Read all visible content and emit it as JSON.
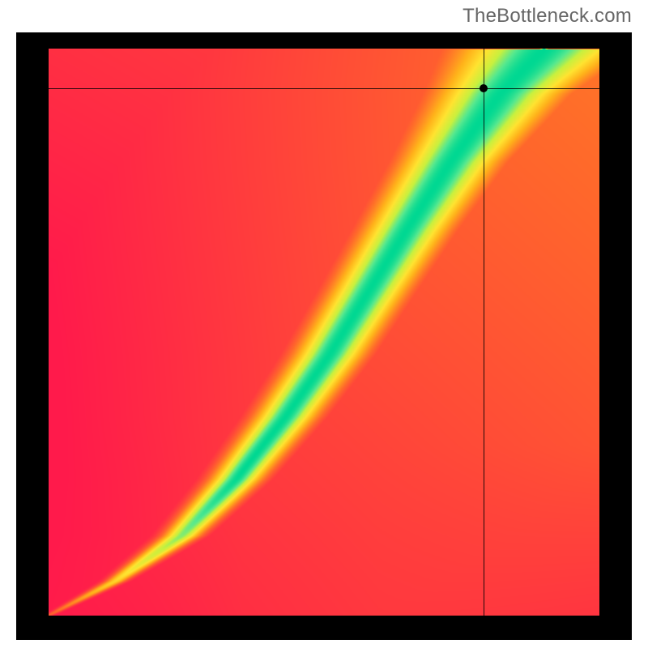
{
  "watermark": "TheBottleneck.com",
  "chart_data": {
    "type": "heatmap",
    "title": "",
    "xlabel": "",
    "ylabel": "",
    "xlim": [
      0,
      100
    ],
    "ylim": [
      0,
      100
    ],
    "grid": false,
    "crosshair": {
      "x": 79,
      "y": 93
    },
    "ridge": [
      {
        "x": 0,
        "y": 0,
        "half_width": 0.5
      },
      {
        "x": 12,
        "y": 6,
        "half_width": 1.2
      },
      {
        "x": 24,
        "y": 14,
        "half_width": 2.2
      },
      {
        "x": 34,
        "y": 24,
        "half_width": 3.0
      },
      {
        "x": 43,
        "y": 35,
        "half_width": 3.6
      },
      {
        "x": 51,
        "y": 46,
        "half_width": 4.1
      },
      {
        "x": 58,
        "y": 57,
        "half_width": 4.5
      },
      {
        "x": 65,
        "y": 68,
        "half_width": 5.0
      },
      {
        "x": 73,
        "y": 80,
        "half_width": 5.8
      },
      {
        "x": 82,
        "y": 92,
        "half_width": 7.5
      },
      {
        "x": 90,
        "y": 100,
        "half_width": 10.0
      }
    ],
    "color_stops": [
      {
        "t": 0.0,
        "color": "#FF1A4B"
      },
      {
        "t": 0.25,
        "color": "#FF6A2A"
      },
      {
        "t": 0.45,
        "color": "#FFB21A"
      },
      {
        "t": 0.62,
        "color": "#FFE330"
      },
      {
        "t": 0.78,
        "color": "#C8F03E"
      },
      {
        "t": 0.9,
        "color": "#55E88F"
      },
      {
        "t": 1.0,
        "color": "#00D892"
      }
    ],
    "side_falloff": 0.022,
    "background_bias_x": 0.45,
    "background_bias_y": 0.55
  },
  "dims": {
    "outer_w": 760,
    "outer_h": 750,
    "inner_w": 680,
    "inner_h": 700,
    "inner_left": 40,
    "inner_top": 20
  }
}
